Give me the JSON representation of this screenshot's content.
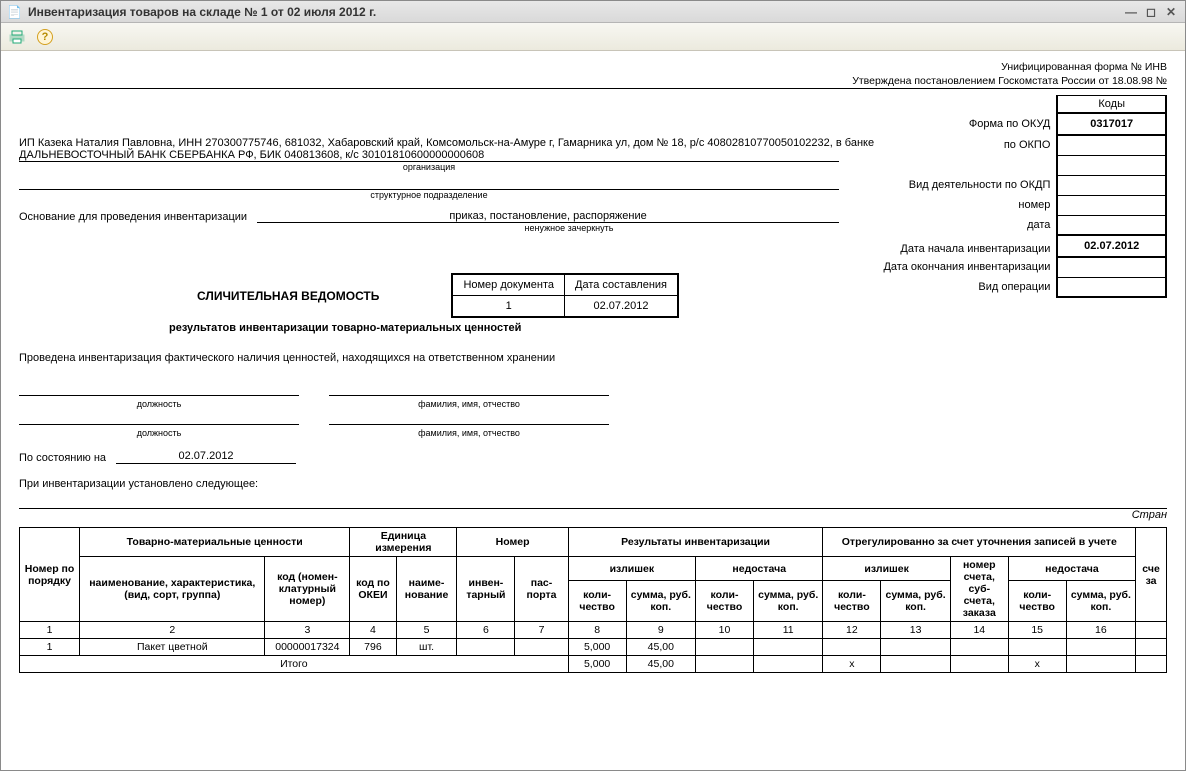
{
  "window": {
    "title": "Инвентаризация товаров на складе № 1 от 02 июля 2012 г."
  },
  "form_header": {
    "line1": "Унифицированная форма № ИНВ",
    "line2": "Утверждена постановлением Госкомстата России от 18.08.98 №"
  },
  "codes": {
    "header": "Коды",
    "rows": [
      {
        "label": "Форма по ОКУД",
        "value": "0317017"
      },
      {
        "label": "по ОКПО",
        "value": ""
      },
      {
        "label": "",
        "value": ""
      },
      {
        "label": "Вид деятельности по ОКДП",
        "value": ""
      },
      {
        "label": "номер",
        "value": ""
      },
      {
        "label": "дата",
        "value": ""
      },
      {
        "label": "Дата начала инвентаризации",
        "value": "02.07.2012"
      },
      {
        "label": "Дата окончания инвентаризации",
        "value": ""
      },
      {
        "label": "Вид операции",
        "value": ""
      }
    ]
  },
  "org": {
    "line1": "ИП Казека Наталия Павловна, ИНН 270300775746, 681032, Хабаровский край, Комсомольск-на-Амуре г, Гамарника ул, дом № 18, р/с 40802810770050102232, в банке",
    "line2": "ДАЛЬНЕВОСТОЧНЫЙ БАНК СБЕРБАНКА РФ, БИК 040813608, к/с 30101810600000000608",
    "sublabel1": "организация",
    "sublabel2": "структурное подразделение"
  },
  "basis": {
    "label": "Основание для проведения инвентаризации",
    "value": "приказ, постановление, распоряжение",
    "sublabel": "ненужное зачеркнуть"
  },
  "doc_box": {
    "col1": "Номер документа",
    "col2": "Дата составления",
    "num": "1",
    "date": "02.07.2012"
  },
  "titles": {
    "main": "СЛИЧИТЕЛЬНАЯ ВЕДОМОСТЬ",
    "sub": "результатов инвентаризации товарно-материальных ценностей",
    "intro": "Проведена инвентаризация фактического наличия ценностей, находящихся на ответственном хранении",
    "position": "должность",
    "fio": "фамилия, имя, отчество",
    "status_label": "По состоянию на",
    "status_date": "02.07.2012",
    "found": "При инвентаризации установлено следующее:",
    "page": "Стран"
  },
  "table": {
    "headers": {
      "num": "Номер по порядку",
      "tmc": "Товарно-материальные ценности",
      "unit": "Единица измерения",
      "number": "Номер",
      "results": "Результаты инвентаризации",
      "adjusted": "Отрегулированно за счет уточнения записей в учете",
      "name": "наименование, характеристика, (вид, сорт, группа)",
      "code": "код (номен-клатурный номер)",
      "okei": "код по ОКЕИ",
      "unit_name": "наиме-нование",
      "inv_num": "инвен-тарный",
      "passport": "пас-порта",
      "surplus": "излишек",
      "shortage": "недостача",
      "qty": "коли-чество",
      "sum": "сумма, руб. коп.",
      "acct": "номер счета, суб-счета, заказа",
      "sche": "сче за"
    },
    "col_nums": [
      "1",
      "2",
      "3",
      "4",
      "5",
      "6",
      "7",
      "8",
      "9",
      "10",
      "11",
      "12",
      "13",
      "14",
      "15",
      "16"
    ],
    "rows": [
      {
        "n": "1",
        "name": "Пакет цветной",
        "code": "00000017324",
        "okei": "796",
        "unit": "шт.",
        "inv": "",
        "pass": "",
        "s_qty": "5,000",
        "s_sum": "45,00",
        "d_qty": "",
        "d_sum": "",
        "a_s_qty": "",
        "a_s_sum": "",
        "acct": "",
        "a_d_qty": "",
        "a_d_sum": ""
      }
    ],
    "total_label": "Итого",
    "totals": {
      "s_qty": "5,000",
      "s_sum": "45,00",
      "a_s_qty": "x",
      "a_d_qty": "x"
    }
  }
}
